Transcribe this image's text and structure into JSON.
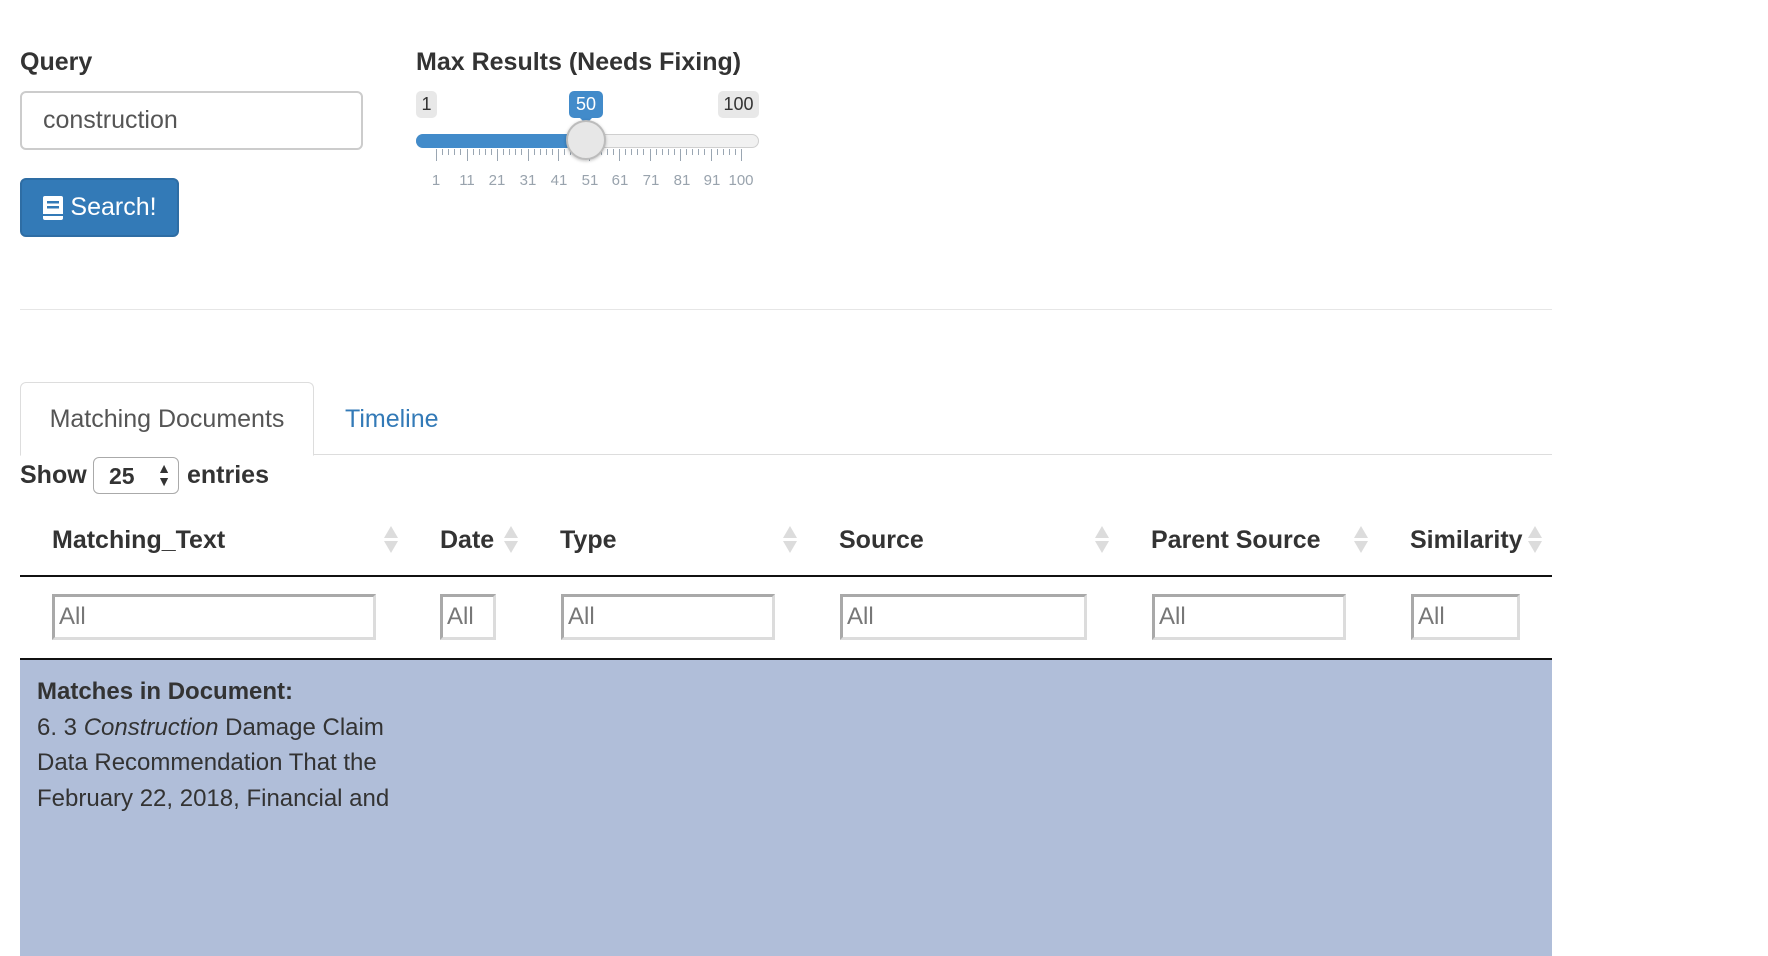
{
  "query": {
    "label": "Query",
    "value": "construction"
  },
  "search_button": {
    "label": "Search!",
    "icon": "book-icon"
  },
  "slider": {
    "label": "Max Results (Needs Fixing)",
    "min": 1,
    "max": 100,
    "value": 50,
    "min_label": "1",
    "max_label": "100",
    "value_label": "50",
    "tick_labels": [
      "1",
      "11",
      "21",
      "31",
      "41",
      "51",
      "61",
      "71",
      "81",
      "91",
      "100"
    ],
    "accent_color": "#428bca"
  },
  "tabs": [
    {
      "label": "Matching Documents",
      "active": true
    },
    {
      "label": "Timeline",
      "active": false
    }
  ],
  "length_menu": {
    "show": "Show",
    "value": "25",
    "entries": "entries"
  },
  "table": {
    "columns": [
      "Matching_Text",
      "Date",
      "Type",
      "Source",
      "Parent Source",
      "Similarity"
    ],
    "filter_placeholder": "All",
    "row_highlight_color": "#b0bed9",
    "first_row": {
      "heading": "Matches in Document:",
      "prefix": "6. 3 ",
      "highlight": "Construction",
      "rest": " Damage Claim Data Recommendation That the February 22, 2018, Financial and"
    }
  }
}
